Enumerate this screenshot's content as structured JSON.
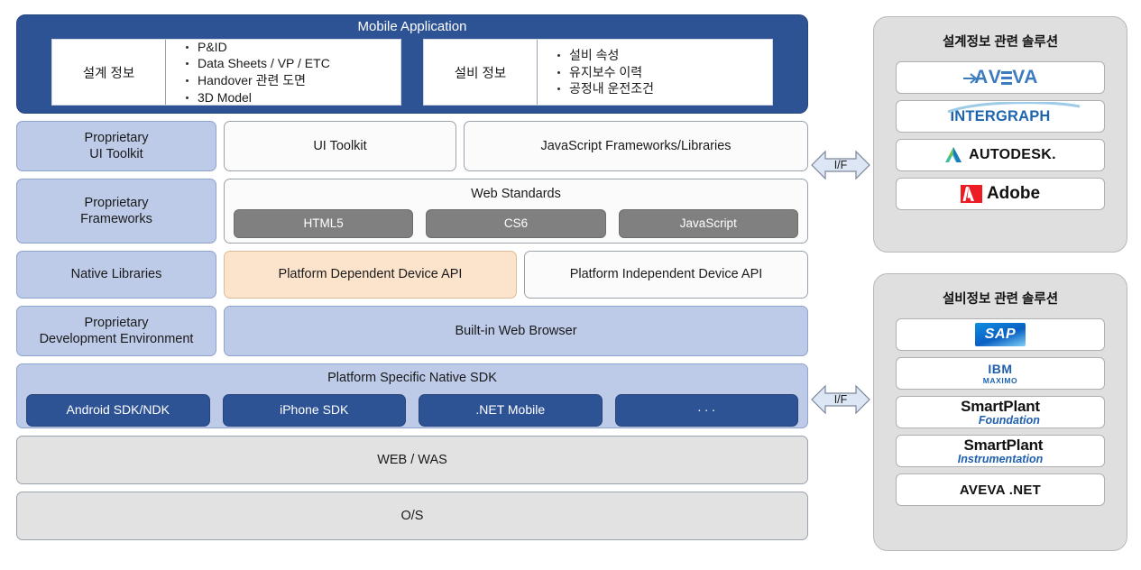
{
  "mobile_app": {
    "title": "Mobile Application",
    "cards": [
      {
        "label": "설계 정보",
        "items": [
          "P&ID",
          "Data Sheets / VP / ETC",
          "Handover 관련 도면",
          "3D Model"
        ]
      },
      {
        "label": "설비 정보",
        "items": [
          "설비 속성",
          "유지보수 이력",
          "공정내 운전조건"
        ]
      }
    ]
  },
  "stack": {
    "row_toolkit": {
      "left": "Proprietary\nUI Toolkit",
      "middle": "UI Toolkit",
      "right": "JavaScript Frameworks/Libraries"
    },
    "row_frameworks": {
      "left": "Proprietary\nFrameworks",
      "group_title": "Web Standards",
      "chips": [
        "HTML5",
        "CS6",
        "JavaScript"
      ]
    },
    "row_device_api": {
      "left": "Native Libraries",
      "middle": "Platform Dependent Device API",
      "right": "Platform Independent Device API"
    },
    "row_browser": {
      "left": "Proprietary\nDevelopment Environment",
      "right": "Built-in Web Browser"
    },
    "row_sdk": {
      "group_title": "Platform Specific Native SDK",
      "chips": [
        "Android SDK/NDK",
        "iPhone SDK",
        ".NET Mobile",
        "∙ ∙ ∙"
      ]
    },
    "row_web_was": "WEB / WAS",
    "row_os": "O/S"
  },
  "connectors": {
    "top_label": "I/F",
    "bottom_label": "I/F"
  },
  "panels": [
    {
      "title": "설계정보 관련 솔루션",
      "logos": [
        {
          "name": "aveva-logo",
          "text": "AVEVA"
        },
        {
          "name": "intergraph-logo",
          "text": "INTERGRAPH"
        },
        {
          "name": "autodesk-logo",
          "text": "AUTODESK."
        },
        {
          "name": "adobe-logo",
          "text": "Adobe"
        }
      ]
    },
    {
      "title": "설비정보 관련 솔루션",
      "logos": [
        {
          "name": "sap-logo",
          "text": "SAP"
        },
        {
          "name": "ibm-maximo-logo",
          "text": "IBM",
          "sub": "MAXIMO"
        },
        {
          "name": "smartplant-foundation-logo",
          "text": "SmartPlant",
          "sub": "Foundation"
        },
        {
          "name": "smartplant-instrumentation-logo",
          "text": "SmartPlant",
          "sub": "Instrumentation"
        },
        {
          "name": "aveva-net-logo",
          "text": "AVEVA .NET"
        }
      ]
    }
  ],
  "colors": {
    "dark_blue": "#2E5395",
    "light_blue": "#BDCAE8",
    "peach": "#FCE4CC",
    "gray": "#E2E2E2",
    "chip_gray": "#808080",
    "panel_bg": "#DFDFDF"
  }
}
